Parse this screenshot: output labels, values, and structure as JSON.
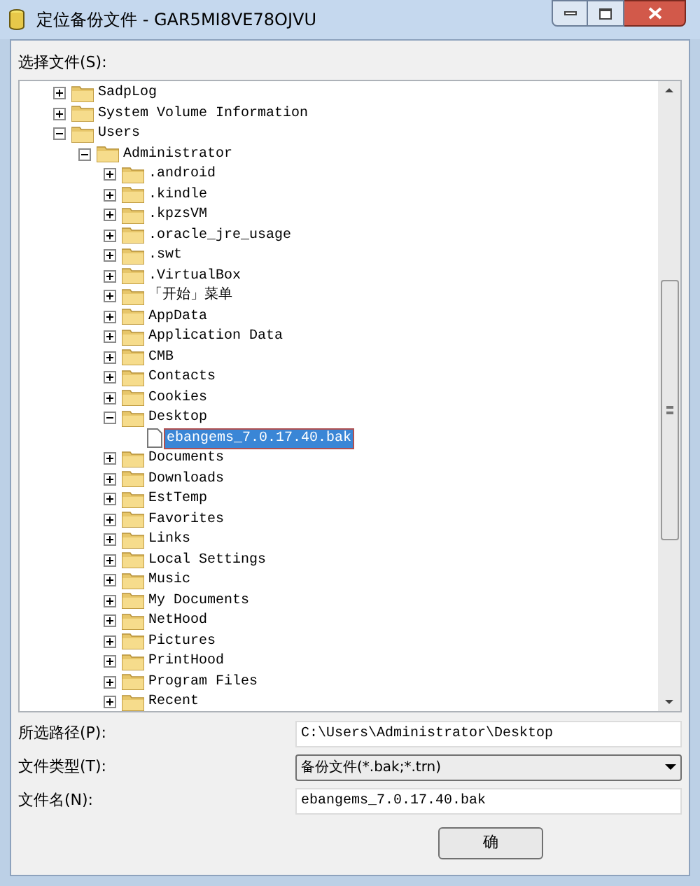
{
  "window": {
    "title": "定位备份文件 - GAR5MI8VE78OJVU"
  },
  "tree_label": "选择文件(S):",
  "tree": [
    {
      "label": "SadpLog",
      "kind": "folder",
      "expanded": false,
      "selected": false
    },
    {
      "label": "System Volume Information",
      "kind": "folder",
      "expanded": false,
      "selected": false
    },
    {
      "label": "Users",
      "kind": "folder",
      "expanded": true,
      "selected": false,
      "children": [
        {
          "label": "Administrator",
          "kind": "folder",
          "expanded": true,
          "selected": false,
          "children": [
            {
              "label": ".android",
              "kind": "folder",
              "expanded": false,
              "selected": false
            },
            {
              "label": ".kindle",
              "kind": "folder",
              "expanded": false,
              "selected": false
            },
            {
              "label": ".kpzsVM",
              "kind": "folder",
              "expanded": false,
              "selected": false
            },
            {
              "label": ".oracle_jre_usage",
              "kind": "folder",
              "expanded": false,
              "selected": false
            },
            {
              "label": ".swt",
              "kind": "folder",
              "expanded": false,
              "selected": false
            },
            {
              "label": ".VirtualBox",
              "kind": "folder",
              "expanded": false,
              "selected": false
            },
            {
              "label": "「开始」菜单",
              "kind": "folder",
              "expanded": false,
              "selected": false
            },
            {
              "label": "AppData",
              "kind": "folder",
              "expanded": false,
              "selected": false
            },
            {
              "label": "Application Data",
              "kind": "folder",
              "expanded": false,
              "selected": false
            },
            {
              "label": "CMB",
              "kind": "folder",
              "expanded": false,
              "selected": false
            },
            {
              "label": "Contacts",
              "kind": "folder",
              "expanded": false,
              "selected": false
            },
            {
              "label": "Cookies",
              "kind": "folder",
              "expanded": false,
              "selected": false
            },
            {
              "label": "Desktop",
              "kind": "folder",
              "expanded": true,
              "selected": false,
              "children": [
                {
                  "label": "ebangems_7.0.17.40.bak",
                  "kind": "file",
                  "selected": true
                }
              ]
            },
            {
              "label": "Documents",
              "kind": "folder",
              "expanded": false,
              "selected": false
            },
            {
              "label": "Downloads",
              "kind": "folder",
              "expanded": false,
              "selected": false
            },
            {
              "label": "EstTemp",
              "kind": "folder",
              "expanded": false,
              "selected": false
            },
            {
              "label": "Favorites",
              "kind": "folder",
              "expanded": false,
              "selected": false
            },
            {
              "label": "Links",
              "kind": "folder",
              "expanded": false,
              "selected": false
            },
            {
              "label": "Local Settings",
              "kind": "folder",
              "expanded": false,
              "selected": false
            },
            {
              "label": "Music",
              "kind": "folder",
              "expanded": false,
              "selected": false
            },
            {
              "label": "My Documents",
              "kind": "folder",
              "expanded": false,
              "selected": false
            },
            {
              "label": "NetHood",
              "kind": "folder",
              "expanded": false,
              "selected": false
            },
            {
              "label": "Pictures",
              "kind": "folder",
              "expanded": false,
              "selected": false
            },
            {
              "label": "PrintHood",
              "kind": "folder",
              "expanded": false,
              "selected": false
            },
            {
              "label": "Program Files",
              "kind": "folder",
              "expanded": false,
              "selected": false
            },
            {
              "label": "Recent",
              "kind": "folder",
              "expanded": false,
              "selected": false
            }
          ]
        }
      ]
    }
  ],
  "fields": [
    {
      "label": "所选路径(P):",
      "kind": "text",
      "value": "C:\\Users\\Administrator\\Desktop"
    },
    {
      "label": "文件类型(T):",
      "kind": "dropdown",
      "value": "备份文件(*.bak;*.trn)"
    },
    {
      "label": "文件名(N):",
      "kind": "text",
      "value": "ebangems_7.0.17.40.bak"
    }
  ],
  "buttons": [
    "确"
  ]
}
